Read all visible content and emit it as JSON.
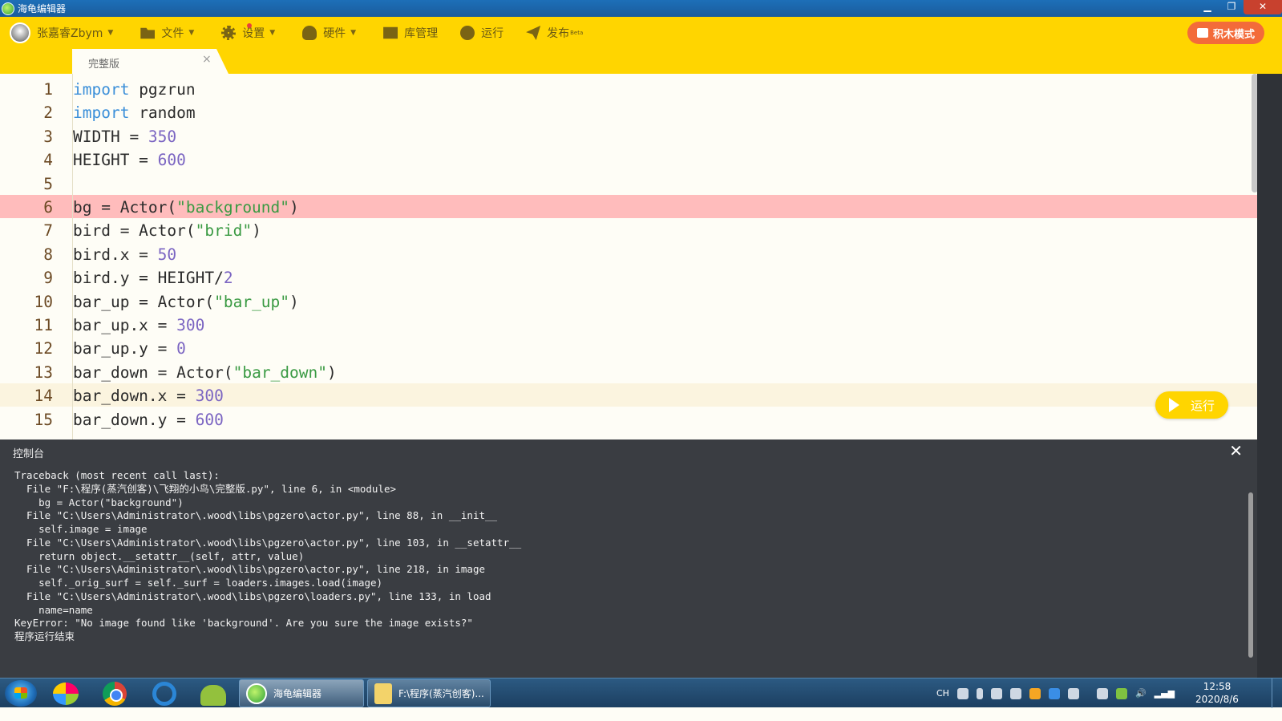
{
  "window": {
    "title": "海龟编辑器"
  },
  "toolbar": {
    "user": "张嘉睿Zbym",
    "file": "文件",
    "settings": "设置",
    "hardware": "硬件",
    "library": "库管理",
    "run": "运行",
    "publish": "发布",
    "publish_badge": "Beta",
    "block_mode": "积木模式"
  },
  "tab": {
    "label": "完整版",
    "close": "×"
  },
  "editor": {
    "error_line": 6,
    "current_line": 14,
    "lines": [
      {
        "n": "1",
        "tokens": [
          [
            "kw",
            "import"
          ],
          [
            "t",
            " pgzrun"
          ]
        ]
      },
      {
        "n": "2",
        "tokens": [
          [
            "kw",
            "import"
          ],
          [
            "t",
            " random"
          ]
        ]
      },
      {
        "n": "3",
        "tokens": [
          [
            "t",
            "WIDTH = "
          ],
          [
            "num",
            "350"
          ]
        ]
      },
      {
        "n": "4",
        "tokens": [
          [
            "t",
            "HEIGHT = "
          ],
          [
            "num",
            "600"
          ]
        ]
      },
      {
        "n": "5",
        "tokens": []
      },
      {
        "n": "6",
        "tokens": [
          [
            "t",
            "bg = Actor("
          ],
          [
            "str",
            "\"background\""
          ],
          [
            "t",
            ")"
          ]
        ]
      },
      {
        "n": "7",
        "tokens": [
          [
            "t",
            "bird = Actor("
          ],
          [
            "str",
            "\"brid\""
          ],
          [
            "t",
            ")"
          ]
        ]
      },
      {
        "n": "8",
        "tokens": [
          [
            "t",
            "bird.x = "
          ],
          [
            "num",
            "50"
          ]
        ]
      },
      {
        "n": "9",
        "tokens": [
          [
            "t",
            "bird.y = HEIGHT/"
          ],
          [
            "num",
            "2"
          ]
        ]
      },
      {
        "n": "10",
        "tokens": [
          [
            "t",
            "bar_up = Actor("
          ],
          [
            "str",
            "\"bar_up\""
          ],
          [
            "t",
            ")"
          ]
        ]
      },
      {
        "n": "11",
        "tokens": [
          [
            "t",
            "bar_up.x = "
          ],
          [
            "num",
            "300"
          ]
        ]
      },
      {
        "n": "12",
        "tokens": [
          [
            "t",
            "bar_up.y = "
          ],
          [
            "num",
            "0"
          ]
        ]
      },
      {
        "n": "13",
        "tokens": [
          [
            "t",
            "bar_down = Actor("
          ],
          [
            "str",
            "\"bar_down\""
          ],
          [
            "t",
            ")"
          ]
        ]
      },
      {
        "n": "14",
        "tokens": [
          [
            "t",
            "bar_down.x = "
          ],
          [
            "num",
            "300"
          ]
        ]
      },
      {
        "n": "15",
        "tokens": [
          [
            "t",
            "bar_down.y = "
          ],
          [
            "num",
            "600"
          ]
        ]
      }
    ],
    "run_button": "运行"
  },
  "console": {
    "title": "控制台",
    "close": "✕",
    "output": "Traceback (most recent call last):\n  File \"F:\\程序(蒸汽创客)\\飞翔的小鸟\\完整版.py\", line 6, in <module>\n    bg = Actor(\"background\")\n  File \"C:\\Users\\Administrator\\.wood\\libs\\pgzero\\actor.py\", line 88, in __init__\n    self.image = image\n  File \"C:\\Users\\Administrator\\.wood\\libs\\pgzero\\actor.py\", line 103, in __setattr__\n    return object.__setattr__(self, attr, value)\n  File \"C:\\Users\\Administrator\\.wood\\libs\\pgzero\\actor.py\", line 218, in image\n    self._orig_surf = self._surf = loaders.images.load(image)\n  File \"C:\\Users\\Administrator\\.wood\\libs\\pgzero\\loaders.py\", line 133, in load\n    name=name\nKeyError: \"No image found like 'background'. Are you sure the image exists?\"\n程序运行结束"
  },
  "taskbar": {
    "tasks": [
      {
        "label": "海龟编辑器",
        "active": true
      },
      {
        "label": "F:\\程序(蒸汽创客)..."
      }
    ],
    "tray_lang": "CH",
    "time": "12:58",
    "date": "2020/8/6"
  },
  "colors": {
    "toolbar": "#ffd500",
    "error_line": "#ffbcbc",
    "console_bg": "#3a3d42",
    "keyword": "#3b8fd9",
    "number": "#7b65c2",
    "string": "#3a9a43"
  }
}
